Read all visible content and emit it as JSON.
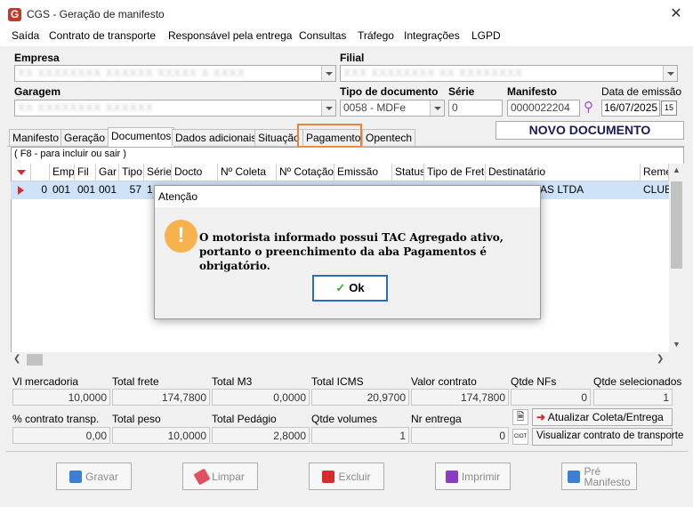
{
  "window": {
    "title": "CGS - Geração de manifesto",
    "close": "✕",
    "app_icon": "G"
  },
  "menu": [
    "Saída",
    "Contrato de transporte",
    "Responsável pela entrega",
    "Consultas",
    "Tráfego",
    "Integrações",
    "LGPD"
  ],
  "form": {
    "empresa_label": "Empresa",
    "empresa_value": "XX XXXXXXXX XXXXXX XXXXX X XXXX",
    "filial_label": "Filial",
    "filial_value": "XXX XXXXXXXX XX XXXXXXXX",
    "garagem_label": "Garagem",
    "garagem_value": "XX XXXXXXXX XXXXXX",
    "tipo_doc_label": "Tipo de documento",
    "tipo_doc_value": "0058 - MDFe",
    "serie_label": "Série",
    "serie_value": "0",
    "manifesto_label": "Manifesto",
    "manifesto_value": "0000022204",
    "data_emissao_label": "Data de emissão",
    "data_emissao_value": "16/07/2025",
    "calendar_icon_text": "15"
  },
  "status_banner": "NOVO DOCUMENTO",
  "tabs": [
    "Manifesto",
    "Geração",
    "Documentos",
    "Dados adicionais",
    "Situação",
    "Pagamento",
    "Opentech"
  ],
  "grid": {
    "hint": "( F8 - para incluir ou sair )",
    "columns": [
      "",
      "Emp",
      "Fil",
      "Gar",
      "Tipo",
      "Série",
      "Docto",
      "Nº Coleta",
      "Nº Cotação",
      "Emissão",
      "Status",
      "Tipo de Frete",
      "Destinatário",
      "Reme"
    ],
    "row": {
      "seq": "0",
      "emp": "001",
      "fil": "001",
      "gar": "001",
      "tipo": "57",
      "serie": "1",
      "destinatario": "AS LTDA",
      "reme": "CLUB"
    }
  },
  "totals": {
    "vl_mercadoria_label": "Vl mercadoria",
    "vl_mercadoria": "10,0000",
    "total_frete_label": "Total frete",
    "total_frete": "174,7800",
    "total_m3_label": "Total M3",
    "total_m3": "0,0000",
    "total_icms_label": "Total ICMS",
    "total_icms": "20,9700",
    "valor_contrato_label": "Valor contrato",
    "valor_contrato": "174,7800",
    "qtde_nfs_label": "Qtde NFs",
    "qtde_nfs": "0",
    "qtde_sel_label": "Qtde selecionados",
    "qtde_sel": "1",
    "pct_contrato_label": "% contrato transp.",
    "pct_contrato": "0,00",
    "total_peso_label": "Total peso",
    "total_peso": "10,0000",
    "total_pedagio_label": "Total Pedágio",
    "total_pedagio": "2,8000",
    "qtde_volumes_label": "Qtde volumes",
    "qtde_volumes": "1",
    "nr_entrega_label": "Nr entrega",
    "nr_entrega": "0",
    "atualizar_btn": "Atualizar Coleta/Entrega",
    "visualizar_btn": "Visualizar contrato de transporte",
    "ciot_icon_text": "CIOT"
  },
  "buttons": {
    "gravar": "Gravar",
    "limpar": "Limpar",
    "excluir": "Excluir",
    "imprimir": "Imprimir",
    "pre_manifesto": "Pré\nManifesto"
  },
  "dialog": {
    "title": "Atenção",
    "icon": "!",
    "message": "O motorista informado possui TAC Agregado ativo, portanto o preenchimento da aba Pagamentos é obrigatório.",
    "ok": "Ok",
    "check": "✓"
  },
  "colors": {
    "accent": "#2a6cc0",
    "highlight": "#e8833a",
    "warning": "#f6b24d"
  }
}
